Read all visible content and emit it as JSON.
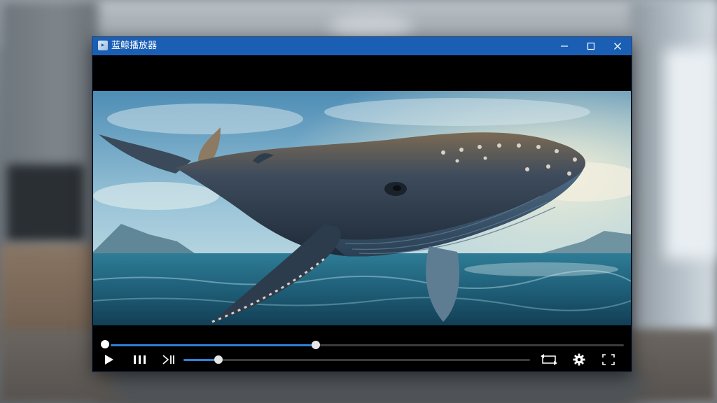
{
  "window": {
    "title": "蓝鲸播放器",
    "icon": "app-logo-icon",
    "controls": [
      "minimize-icon",
      "maximize-icon",
      "close-icon"
    ]
  },
  "video": {
    "scene": "humpback-whale-over-ocean"
  },
  "playback": {
    "progress": 0.4,
    "volume": 0.1
  },
  "controls": {
    "left": [
      "play-icon",
      "pause-icon",
      "next-icon"
    ],
    "right": [
      "loop-icon",
      "settings-icon",
      "fullscreen-icon"
    ]
  },
  "colors": {
    "titlebar": "#1a5fb4",
    "accent": "#2f7fd4",
    "track": "#3b3b3b",
    "controls_bg": "#000000"
  }
}
